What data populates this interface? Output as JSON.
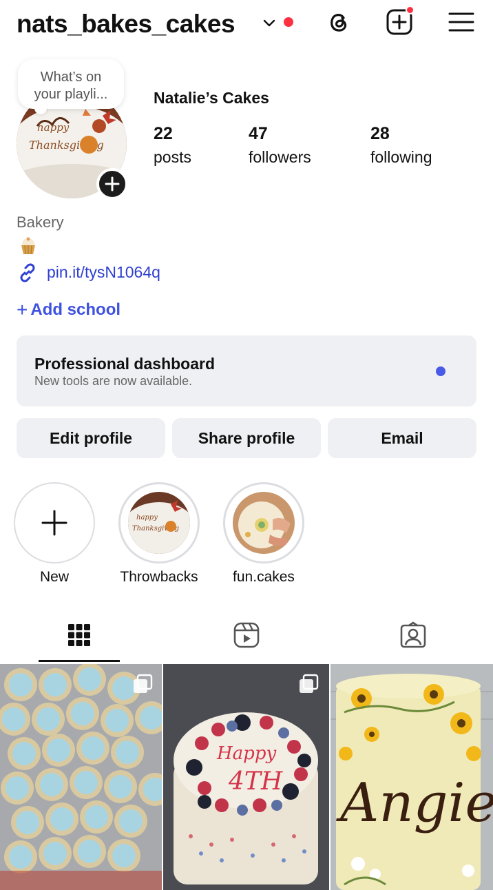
{
  "header": {
    "username": "nats_bakes_cakes"
  },
  "note": {
    "text_line1": "What’s on",
    "text_line2": "your playli..."
  },
  "profile": {
    "display_name": "Natalie’s Cakes",
    "stats": [
      {
        "value": "22",
        "label": "posts"
      },
      {
        "value": "47",
        "label": "followers"
      },
      {
        "value": "28",
        "label": "following"
      }
    ],
    "category": "Bakery",
    "link": "pin.it/tysN1064q",
    "add_school": "Add school"
  },
  "dashboard": {
    "title": "Professional dashboard",
    "subtitle": "New tools are now available."
  },
  "buttons": {
    "edit": "Edit profile",
    "share": "Share profile",
    "email": "Email"
  },
  "highlights": [
    {
      "label": "New"
    },
    {
      "label": "Throwbacks"
    },
    {
      "label": "fun.cakes"
    }
  ],
  "tabs": [
    "grid-icon",
    "reels-icon",
    "tagged-icon"
  ],
  "colors": {
    "link_blue": "#2f3fd1",
    "accent_blue": "#3f51e0",
    "notification_red": "#ff3040",
    "button_bg": "#eff0f3"
  }
}
